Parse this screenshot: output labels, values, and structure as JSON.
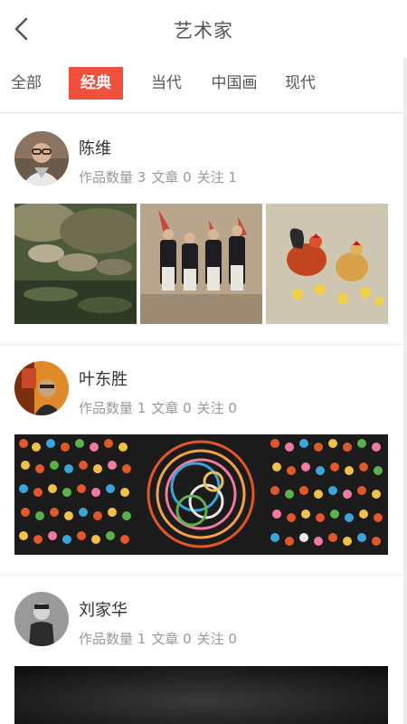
{
  "header": {
    "title": "艺术家"
  },
  "tabs": [
    {
      "label": "全部"
    },
    {
      "label": "经典"
    },
    {
      "label": "当代"
    },
    {
      "label": "中国画"
    },
    {
      "label": "现代"
    }
  ],
  "artists": [
    {
      "name": "陈维",
      "works": "作品数量 3",
      "articles": "文章 0",
      "follows": "关注 1"
    },
    {
      "name": "叶东胜",
      "works": "作品数量 1",
      "articles": "文章 0",
      "follows": "关注 0"
    },
    {
      "name": "刘家华",
      "works": "作品数量 1",
      "articles": "文章 0",
      "follows": "关注 0"
    }
  ],
  "colors": {
    "accent": "#f0503c",
    "meta_text": "#999999"
  }
}
